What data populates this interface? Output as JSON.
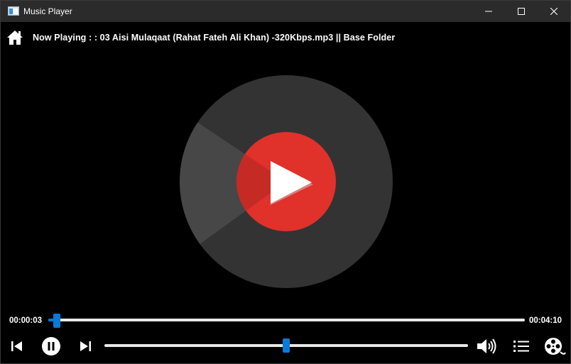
{
  "window": {
    "title": "Music Player",
    "icon": "app-window-icon",
    "controls": [
      "minimize-icon",
      "maximize-icon",
      "close-icon"
    ]
  },
  "header": {
    "home_icon": "home-icon",
    "now_playing": "Now Playing : : 03 Aisi Mulaqaat (Rahat Fateh Ali Khan) -320Kbps.mp3 || Base Folder"
  },
  "album_art": {
    "icon": "play-logo-icon",
    "disc_color": "#333333",
    "center_color": "#e0312b"
  },
  "seek": {
    "current_time": "00:00:03",
    "total_time": "00:04:10",
    "progress": 0.012
  },
  "controls": {
    "previous": "skip-previous-icon",
    "pause": "pause-icon",
    "next": "skip-next-icon",
    "volume_level": 0.5,
    "volume": "volume-icon",
    "playlist": "playlist-icon",
    "media_library": "film-reel-icon"
  },
  "colors": {
    "accent": "#0078d7",
    "background": "#000000",
    "titlebar": "#2b2b2b",
    "track": "#e8e8e8"
  }
}
